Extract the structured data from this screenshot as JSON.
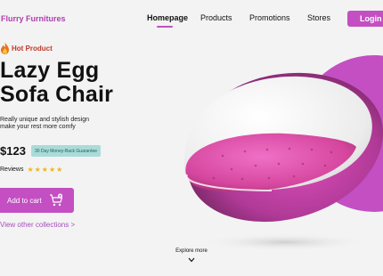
{
  "brand": "Flurry Furnitures",
  "nav": {
    "items": [
      "Homepage",
      "Products",
      "Promotions",
      "Stores"
    ],
    "login": "Login"
  },
  "badge": {
    "label": "Hot Product",
    "icon": "fire-icon"
  },
  "product": {
    "title_line1": "Lazy Egg",
    "title_line2": "Sofa Chair",
    "desc_line1": "Really unique and stylish design",
    "desc_line2": "make your rest more comfy",
    "price": "$123",
    "guarantee": "30 Day Money-Back Guarantee",
    "reviews_label": "Reviews",
    "rating_stars": 5
  },
  "actions": {
    "add_to_cart": "Add to cart",
    "view_collections": "View other collections >",
    "explore_more": "Explore more"
  },
  "colors": {
    "accent": "#c34fc3",
    "badge": "#c0392b",
    "guarantee_bg": "#a9dcd9",
    "star": "#f0b419"
  }
}
